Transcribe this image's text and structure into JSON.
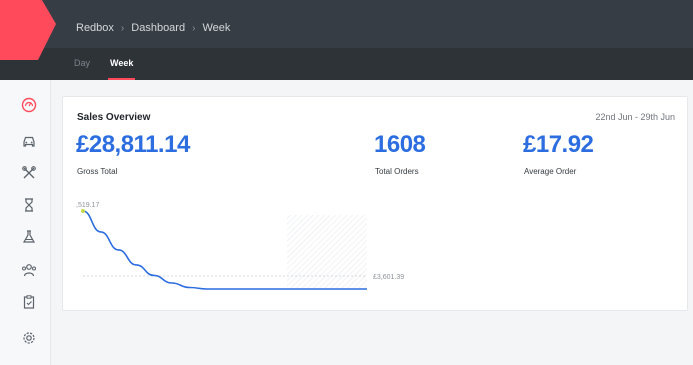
{
  "app": {
    "brand_color": "#ff4a5c",
    "accent": "#2c6de0"
  },
  "breadcrumbs": [
    "Redbox",
    "Dashboard",
    "Week"
  ],
  "tabs": [
    {
      "label": "Day",
      "active": false
    },
    {
      "label": "Week",
      "active": true
    }
  ],
  "sidebar": {
    "items": [
      {
        "icon": "gauge-icon",
        "active": true
      },
      {
        "icon": "car-icon",
        "active": false
      },
      {
        "icon": "tools-icon",
        "active": false
      },
      {
        "icon": "hourglass-icon",
        "active": false
      },
      {
        "icon": "flask-icon",
        "active": false
      },
      {
        "icon": "users-icon",
        "active": false
      },
      {
        "icon": "clipboard-icon",
        "active": false
      },
      {
        "icon": "gear-icon",
        "active": false
      }
    ]
  },
  "overview": {
    "title": "Sales Overview",
    "range": "22nd Jun - 29th Jun",
    "stats": [
      {
        "value": "£28,811.14",
        "label": "Gross Total"
      },
      {
        "value": "1608",
        "label": "Total Orders"
      },
      {
        "value": "£17.92",
        "label": "Average Order"
      }
    ]
  },
  "chart_data": {
    "type": "line",
    "series": [
      {
        "values": [
          519.17,
          380,
          260,
          160,
          90,
          40,
          10,
          0,
          0,
          0,
          0,
          0,
          0,
          0,
          0,
          0,
          0
        ]
      }
    ],
    "start_label": ",519.17",
    "reference_label": "£3,601.39",
    "grid": false
  }
}
